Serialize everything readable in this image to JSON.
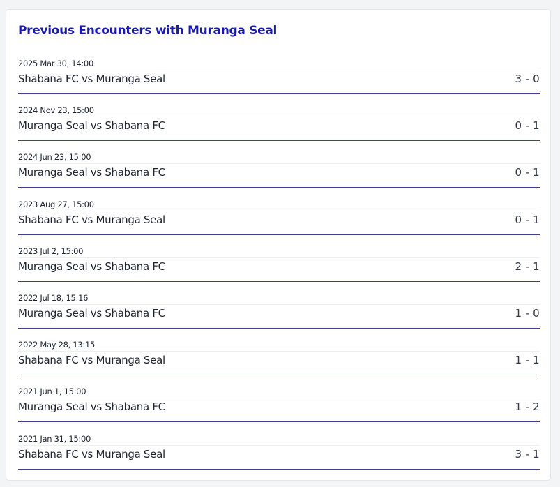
{
  "header": {
    "title": "Previous Encounters with Muranga Seal"
  },
  "matches": [
    {
      "date": "2025 Mar 30, 14:00",
      "teams": "Shabana FC vs Muranga Seal",
      "score": "3 - 0"
    },
    {
      "date": "2024 Nov 23, 15:00",
      "teams": "Muranga Seal vs Shabana FC",
      "score": "0 - 1"
    },
    {
      "date": "2024 Jun 23, 15:00",
      "teams": "Muranga Seal vs Shabana FC",
      "score": "0 - 1"
    },
    {
      "date": "2023 Aug 27, 15:00",
      "teams": "Shabana FC vs Muranga Seal",
      "score": "0 - 1"
    },
    {
      "date": "2023 Jul 2, 15:00",
      "teams": "Muranga Seal vs Shabana FC",
      "score": "2 - 1"
    },
    {
      "date": "2022 Jul 18, 15:16",
      "teams": "Muranga Seal vs Shabana FC",
      "score": "1 - 0"
    },
    {
      "date": "2022 May 28, 13:15",
      "teams": "Shabana FC vs Muranga Seal",
      "score": "1 - 1"
    },
    {
      "date": "2021 Jun 1, 15:00",
      "teams": "Muranga Seal vs Shabana FC",
      "score": "1 - 2"
    },
    {
      "date": "2021 Jan 31, 15:00",
      "teams": "Shabana FC vs Muranga Seal",
      "score": "3 - 1"
    }
  ],
  "colors": {
    "title": "#1a1aa8",
    "divider": "#3d3f8f",
    "text": "#1e2330"
  }
}
